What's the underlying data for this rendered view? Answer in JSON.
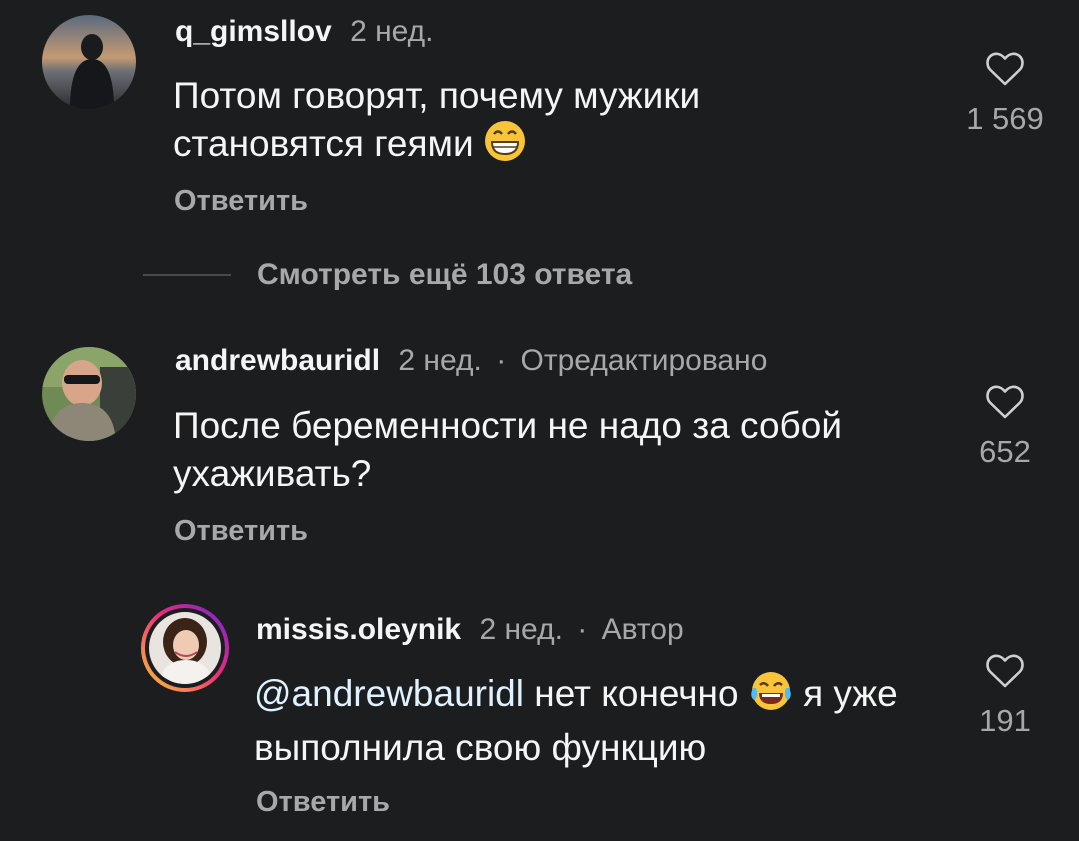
{
  "comments": [
    {
      "username": "q_gimsllov",
      "time": "2 нед.",
      "text": "Потом говорят,  почему мужики становятся геями",
      "emoji": "grinning-face-emoji",
      "reply_label": "Ответить",
      "likes": "1 569"
    },
    {
      "username": "andrewbauridl",
      "time": "2 нед.",
      "separator": "·",
      "edited_label": "Отредактировано",
      "text": "После беременности не надо за собой ухаживать?",
      "reply_label": "Ответить",
      "likes": "652"
    },
    {
      "username": "missis.oleynik",
      "time": "2 нед.",
      "separator": "·",
      "author_label": "Автор",
      "mention": "@andrewbauridl",
      "text_before_emoji": "нет конечно",
      "emoji": "tears-of-joy-emoji",
      "text_after_emoji": "я уже выполнила свою функцию",
      "reply_label": "Ответить",
      "likes": "191"
    }
  ],
  "more_replies_label": "Смотреть ещё 103 ответа",
  "icons": {
    "like": "heart-outline-icon"
  },
  "colors": {
    "background": "#1c1d1f",
    "text": "#f5f5f5",
    "muted": "#a8a8a8",
    "story_ring_start": "#f9ce34",
    "story_ring_mid": "#ee2a7b",
    "story_ring_end": "#6228d7"
  }
}
